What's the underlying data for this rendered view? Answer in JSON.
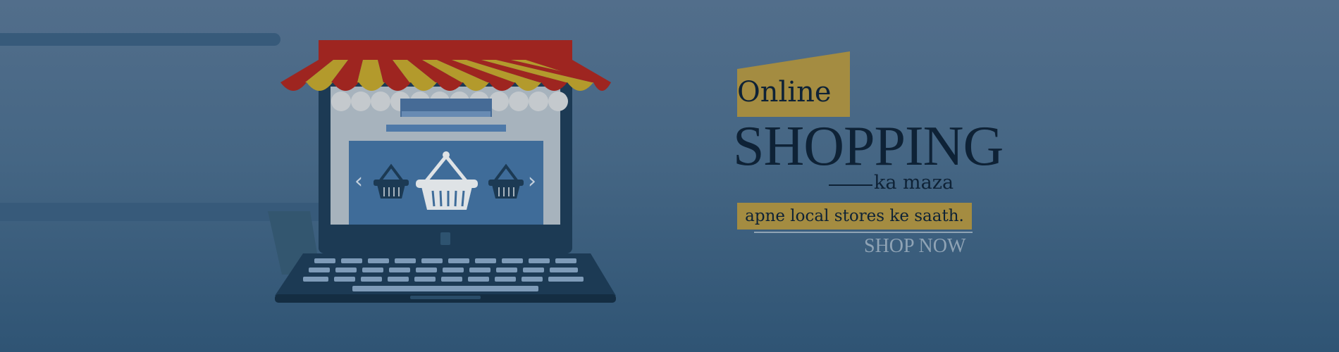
{
  "banner": {
    "headline_online": "Online",
    "headline_shopping": "SHOPPING",
    "headline_maza": "ka maza",
    "tagline": "apne local stores ke saath.",
    "cta_label": "SHOP NOW",
    "carousel_prev": "‹",
    "carousel_next": "›"
  },
  "colors": {
    "background_top": "#526e8b",
    "background_bottom": "#2f5474",
    "accent_gold": "#a48c41",
    "headline_text": "#0e2236",
    "cta_text": "#8fa3b5",
    "awning_red": "#9e2520",
    "awning_yellow": "#b39a2c"
  },
  "icons": {
    "illustration": "laptop-storefront-icon",
    "basket": "shopping-basket-icon"
  }
}
